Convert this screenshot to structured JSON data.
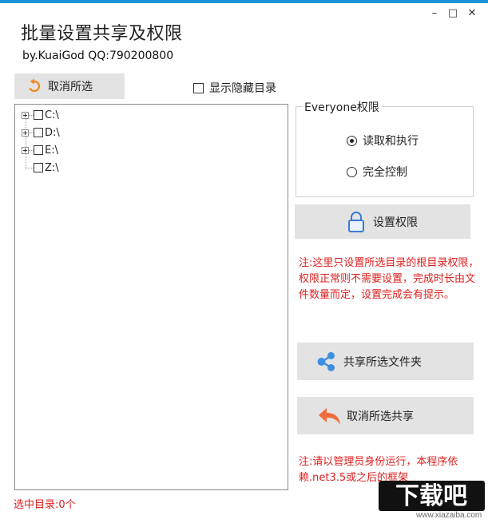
{
  "window": {
    "title": "批量设置共享及权限",
    "subtitle": "by.KuaiGod  QQ:790200800",
    "controls": {
      "minimize": "–",
      "maximize": "□",
      "close": "✕"
    },
    "accent_color": "#1a94d8"
  },
  "toolbar": {
    "undo_select_label": "取消所选",
    "undo_icon": "undo-arrow-icon",
    "show_hidden_label": "显示隐藏目录",
    "show_hidden_checked": false
  },
  "tree": {
    "items": [
      {
        "label": "C:\\",
        "expandable": true,
        "checked": false
      },
      {
        "label": "D:\\",
        "expandable": true,
        "checked": false
      },
      {
        "label": "E:\\",
        "expandable": true,
        "checked": false
      },
      {
        "label": "Z:\\",
        "expandable": false,
        "checked": false
      }
    ]
  },
  "permissions": {
    "group_label": "Everyone权限",
    "options": [
      {
        "label": "读取和执行",
        "selected": true
      },
      {
        "label": "完全控制",
        "selected": false
      }
    ],
    "set_button_label": "设置权限",
    "set_button_icon": "lock-icon",
    "note": "注:这里只设置所选目录的根目录权限，权限正常则不需要设置，完成时长由文件数量而定，设置完成会有提示。"
  },
  "share": {
    "share_button_label": "共享所选文件夹",
    "share_button_icon": "share-icon",
    "unshare_button_label": "取消所选共享",
    "unshare_button_icon": "back-arrow-icon",
    "note": "注:请以管理员身份运行，本程序依赖.net3.5或之后的框架"
  },
  "status": {
    "selected_label": "选中目录:0个"
  },
  "watermark": {
    "logo_text": "下载吧",
    "url_text": "www.xiazaiba.com"
  }
}
